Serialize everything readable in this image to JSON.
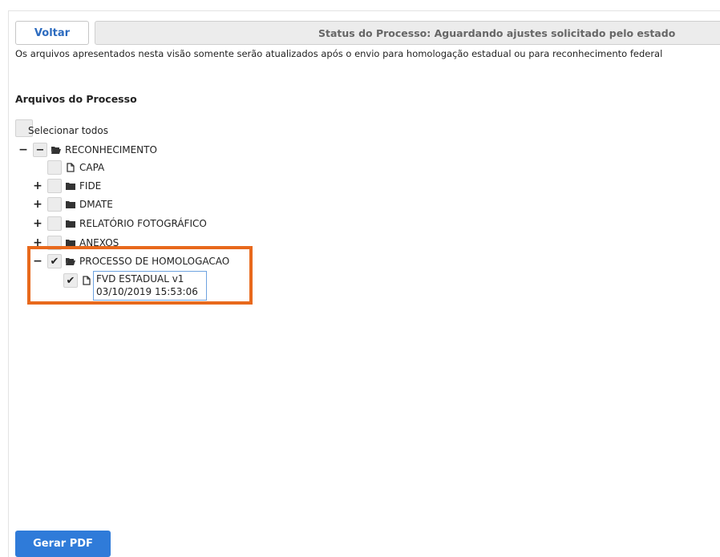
{
  "header": {
    "back_label": "Voltar",
    "status_text": "Status do Processo: Aguardando ajustes solicitado pelo estado"
  },
  "notice": "Os arquivos apresentados nesta visão somente serão atualizados após o envio para homologação estadual ou para reconhecimento federal",
  "section_title": "Arquivos do Processo",
  "tree": {
    "select_all_label": "Selecionar todos",
    "expanded_symbol": "−",
    "collapsed_symbol": "+",
    "check_mark": "✔",
    "reconhecimento": "RECONHECIMENTO",
    "capa": "CAPA",
    "fide": "FIDE",
    "dmate": "DMATE",
    "relatorio": "RELATÓRIO FOTOGRÁFICO",
    "anexos": "ANEXOS",
    "homologacao": "PROCESSO DE HOMOLOGACAO",
    "file_name": "FVD ESTADUAL v1",
    "file_date": "03/10/2019 15:53:06"
  },
  "footer": {
    "gerar_pdf_label": "Gerar PDF"
  },
  "colors": {
    "accent": "#2f7bd9",
    "highlight": "#e8691c"
  }
}
